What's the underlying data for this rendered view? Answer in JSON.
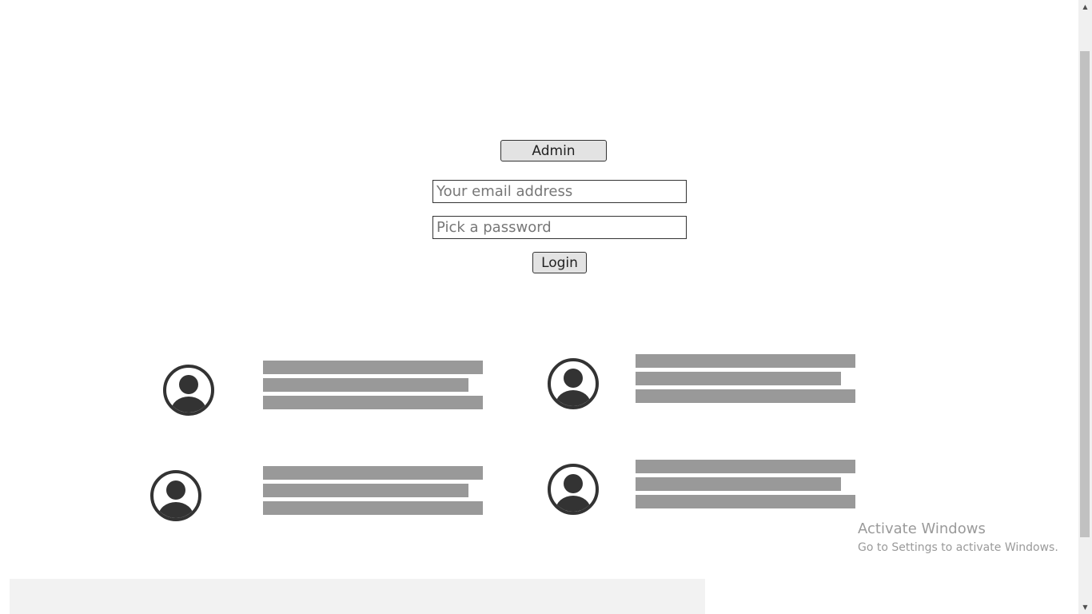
{
  "login": {
    "admin_label": "Admin",
    "email_placeholder": "Your email address",
    "email_value": "",
    "password_placeholder": "Pick a password",
    "password_value": "",
    "login_label": "Login"
  },
  "profiles": [
    {
      "avatar_icon": "user-avatar-icon",
      "text_lines": 3
    },
    {
      "avatar_icon": "user-avatar-icon",
      "text_lines": 3
    },
    {
      "avatar_icon": "user-avatar-icon",
      "text_lines": 3
    },
    {
      "avatar_icon": "user-avatar-icon",
      "text_lines": 3
    }
  ],
  "watermark": {
    "title": "Activate Windows",
    "subtitle": "Go to Settings to activate Windows."
  },
  "scrollbar": {
    "up_icon": "scroll-up-arrow-icon",
    "down_icon": "scroll-down-arrow-icon"
  },
  "colors": {
    "placeholder_bar": "#999999",
    "avatar": "#333333",
    "button_bg": "#e3e3e3",
    "footer_panel": "#f2f2f2"
  }
}
